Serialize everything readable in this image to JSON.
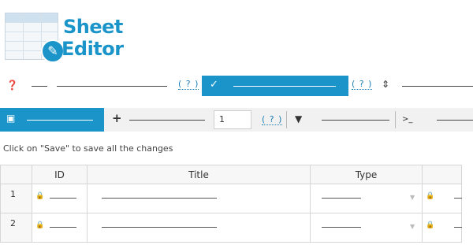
{
  "logo": {
    "line1": "Sheet",
    "line2": "Editor",
    "badge_icon": "pencil-doc-icon"
  },
  "toolbar1": {
    "help_icon": "question-circle-icon",
    "help_link_1": "( ? )",
    "check_icon": "check-icon",
    "help_link_2": "( ? )",
    "sort_icon": "sort-updown-icon"
  },
  "toolbar2": {
    "save_icon": "floppy-disk-icon",
    "plus_icon": "plus-icon",
    "quantity_value": "1",
    "help_link": "( ? )",
    "filter_icon": "filter-icon",
    "terminal_icon": "terminal-icon",
    "terminal_glyph": ">_"
  },
  "hint_text": "Click on \"Save\" to save all the changes",
  "table": {
    "columns": [
      "ID",
      "Title",
      "Type"
    ],
    "rows": [
      {
        "num": "1"
      },
      {
        "num": "2"
      }
    ]
  },
  "colors": {
    "accent": "#1b95c9",
    "toolbar_bg": "#f1f1f1",
    "border": "#d6d6d6"
  }
}
